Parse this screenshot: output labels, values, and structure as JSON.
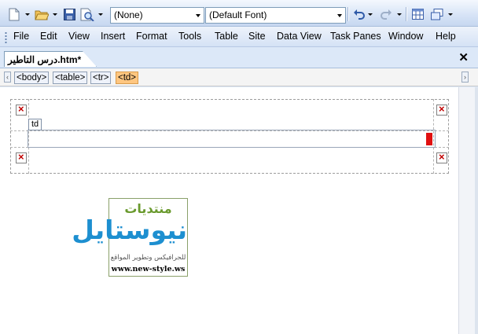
{
  "toolbar": {
    "style_value": "(None)",
    "font_value": "(Default Font)",
    "icons": [
      "new-page-icon",
      "open-folder-icon",
      "save-icon",
      "preview-icon",
      "undo-icon",
      "redo-icon",
      "insert-table-icon",
      "layers-icon"
    ]
  },
  "menu": {
    "items": [
      "File",
      "Edit",
      "View",
      "Insert",
      "Format",
      "Tools",
      "Table",
      "Site",
      "Data View",
      "Task Panes",
      "Window",
      "Help"
    ]
  },
  "document_tab": {
    "title": "درس التاطير.htm*"
  },
  "tag_selector": {
    "tags": [
      "<body>",
      "<table>",
      "<tr>",
      "<td>"
    ],
    "active_index": 3
  },
  "editor": {
    "cell_label": "td"
  },
  "logo": {
    "top_text": "منتديات",
    "main_text": "نيوستايل",
    "sub_text": "للجرافيكس وتطوير المواقع",
    "url": "www.new-style.ws"
  },
  "colors": {
    "active_tag": "#ffc680",
    "resize_handle": "#e01010",
    "broken_image_x": "#c00000"
  }
}
